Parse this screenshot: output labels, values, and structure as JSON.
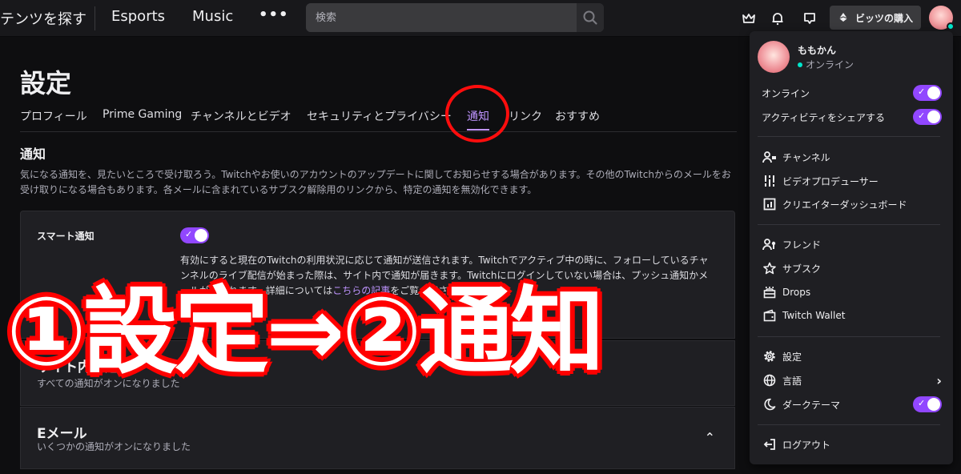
{
  "topbar": {
    "nav_browse": "テンツを探す",
    "nav_esports": "Esports",
    "nav_music": "Music",
    "more": "•••",
    "search_placeholder": "検索",
    "bits_button": "ビッツの購入"
  },
  "main": {
    "title": "設定",
    "tabs": [
      {
        "label": "プロフィール"
      },
      {
        "label": "Prime Gaming"
      },
      {
        "label": "チャンネルとビデオ"
      },
      {
        "label": "セキュリティとプライバシー"
      },
      {
        "label": "通知",
        "active": true
      },
      {
        "label": "リンク"
      },
      {
        "label": "おすすめ"
      }
    ],
    "section_title": "通知",
    "section_desc": "気になる通知を、見たいところで受け取ろう。Twitchやお使いのアカウントのアップデートに関してお知らせする場合があります。その他のTwitchからのメールをお受け取りになる場合もあります。各メールに含まれているサブスク解除用のリンクから、特定の通知を無効化できます。",
    "smart": {
      "label": "スマート通知",
      "enabled": true,
      "desc_1": "有効にすると現在のTwitchの利用状況に応じて通知が送信されます。Twitchでアクティブ中の時に、フォローしているチャンネルのライブ配信が始まった際は、サイト内で通知が届きます。Twitchにログインしていない場合は、プッシュ通知かメールが送られます。詳細については",
      "link": "こちらの記事",
      "desc_2": "をご覧ください。"
    },
    "onsite": {
      "title": "サイト内の通知",
      "sub": "すべての通知がオンになりました"
    },
    "email": {
      "title": "Eメール",
      "sub": "いくつかの通知がオンになりました"
    }
  },
  "menu": {
    "username": "ももかん",
    "status": "オンライン",
    "online_label": "オンライン",
    "online_enabled": true,
    "share_label": "アクティビティをシェアする",
    "share_enabled": true,
    "items_group1": [
      {
        "icon": "channel-icon",
        "label": "チャンネル"
      },
      {
        "icon": "sliders-icon",
        "label": "ビデオプロデューサー"
      },
      {
        "icon": "dashboard-icon",
        "label": "クリエイターダッシュボード"
      }
    ],
    "items_group2": [
      {
        "icon": "friends-icon",
        "label": "フレンド"
      },
      {
        "icon": "star-icon",
        "label": "サブスク"
      },
      {
        "icon": "drops-icon",
        "label": "Drops"
      },
      {
        "icon": "wallet-icon",
        "label": "Twitch Wallet"
      }
    ],
    "settings_label": "設定",
    "language_label": "言語",
    "dark_theme_label": "ダークテーマ",
    "dark_theme_enabled": true,
    "logout_label": "ログアウト"
  },
  "overlay": {
    "annotation": "①設定⇒②通知",
    "accent": "#ff0000"
  },
  "colors": {
    "accent": "#9147ff",
    "accent_text": "#bf94ff",
    "online": "#00e6cb"
  }
}
